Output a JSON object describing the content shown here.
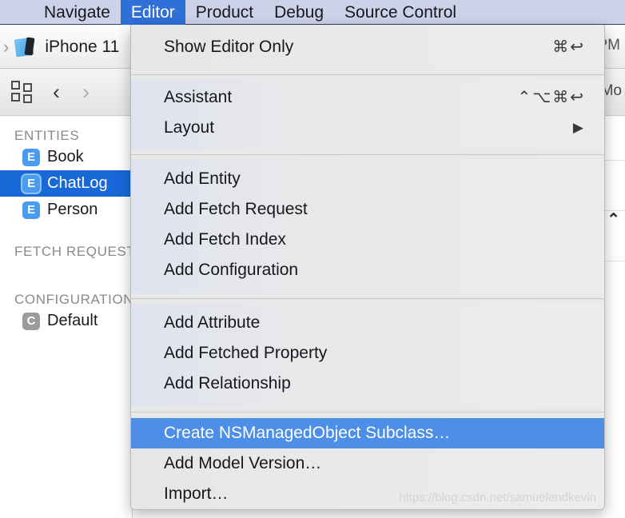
{
  "menubar": {
    "items": [
      {
        "label": "Navigate",
        "active": false
      },
      {
        "label": "Editor",
        "active": true
      },
      {
        "label": "Product",
        "active": false
      },
      {
        "label": "Debug",
        "active": false
      },
      {
        "label": "Source Control",
        "active": false
      }
    ]
  },
  "toolbar": {
    "breadcrumb_chevron": "›",
    "device_icon": "xcode-project-device-icon",
    "device_name": "iPhone 11",
    "clock": "PM"
  },
  "jumpbar": {
    "grid_icon": "entity-grid-icon",
    "back_chevron": "‹",
    "forward_chevron": "›",
    "right_label": "Mo"
  },
  "sidebar": {
    "sections": [
      {
        "header": "ENTITIES",
        "rows": [
          {
            "badge": "E",
            "badge_kind": "entity",
            "label": "Book",
            "selected": false
          },
          {
            "badge": "E",
            "badge_kind": "entity",
            "label": "ChatLog",
            "selected": true
          },
          {
            "badge": "E",
            "badge_kind": "entity",
            "label": "Person",
            "selected": false
          }
        ]
      },
      {
        "header": "FETCH REQUESTS",
        "rows": []
      },
      {
        "header": "CONFIGURATIONS",
        "rows": [
          {
            "badge": "C",
            "badge_kind": "config",
            "label": "Default",
            "selected": false
          }
        ]
      }
    ]
  },
  "editor_pane": {
    "disclose_icon": "chevron-up-icon",
    "disclose_glyph": "⌃"
  },
  "menu": {
    "title": "Editor",
    "groups": [
      {
        "items": [
          {
            "label": "Show Editor Only",
            "shortcut": "⌘↩",
            "submenu": false,
            "highlighted": false
          }
        ]
      },
      {
        "items": [
          {
            "label": "Assistant",
            "shortcut": "⌃⌥⌘↩",
            "submenu": false,
            "highlighted": false
          },
          {
            "label": "Layout",
            "shortcut": "",
            "submenu": true,
            "highlighted": false
          }
        ]
      },
      {
        "items": [
          {
            "label": "Add Entity",
            "shortcut": "",
            "submenu": false,
            "highlighted": false
          },
          {
            "label": "Add Fetch Request",
            "shortcut": "",
            "submenu": false,
            "highlighted": false
          },
          {
            "label": "Add Fetch Index",
            "shortcut": "",
            "submenu": false,
            "highlighted": false
          },
          {
            "label": "Add Configuration",
            "shortcut": "",
            "submenu": false,
            "highlighted": false
          }
        ]
      },
      {
        "items": [
          {
            "label": "Add Attribute",
            "shortcut": "",
            "submenu": false,
            "highlighted": false
          },
          {
            "label": "Add Fetched Property",
            "shortcut": "",
            "submenu": false,
            "highlighted": false
          },
          {
            "label": "Add Relationship",
            "shortcut": "",
            "submenu": false,
            "highlighted": false
          }
        ]
      },
      {
        "items": [
          {
            "label": "Create NSManagedObject Subclass…",
            "shortcut": "",
            "submenu": false,
            "highlighted": true
          },
          {
            "label": "Add Model Version…",
            "shortcut": "",
            "submenu": false,
            "highlighted": false
          },
          {
            "label": "Import…",
            "shortcut": "",
            "submenu": false,
            "highlighted": false
          }
        ]
      }
    ]
  },
  "watermark": {
    "text": "https://blog.csdn.net/samuelandkevin"
  },
  "colors": {
    "menubar_bg": "#ccd2e8",
    "menubar_active": "#2f6fd8",
    "menu_bg": "#e9e9ea",
    "menu_highlight": "#4d8fe8",
    "sidebar_selected": "#1868d8",
    "entity_badge": "#4a9cf0",
    "config_badge": "#9b9b9b"
  }
}
